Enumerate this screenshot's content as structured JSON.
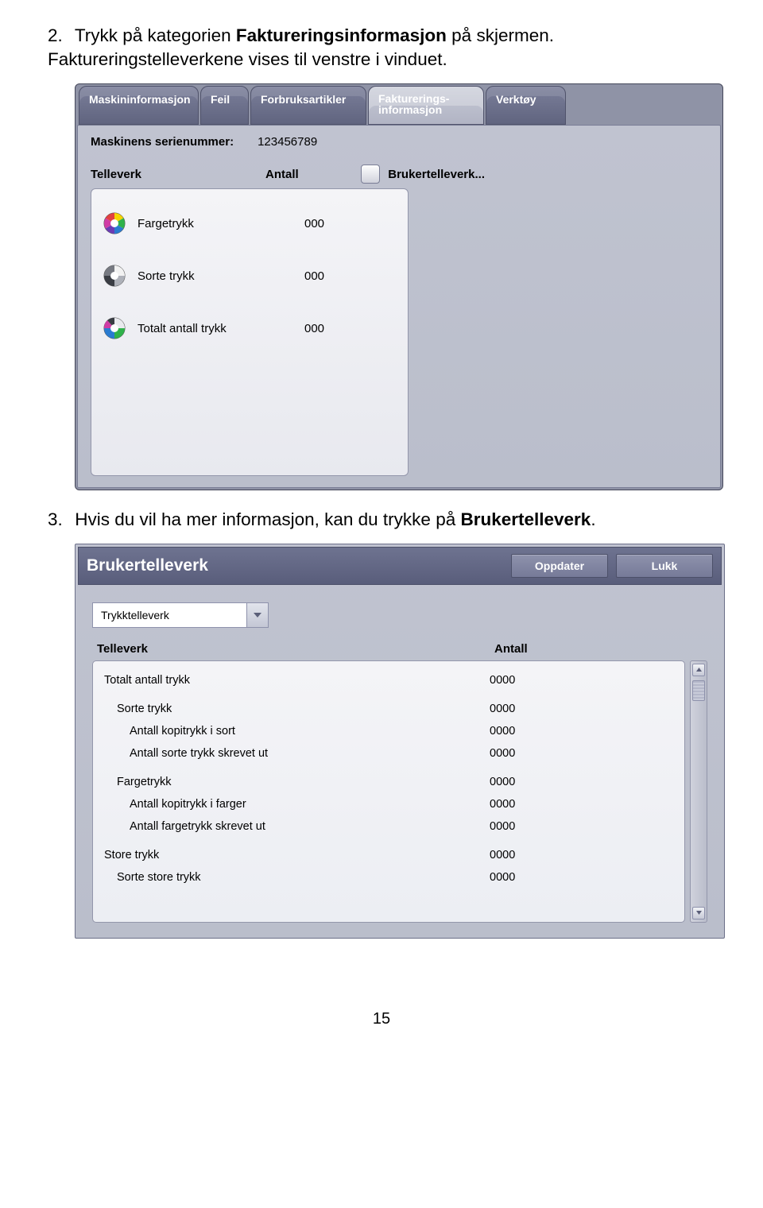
{
  "step2": {
    "num": "2.",
    "text_a": "Trykk på kategorien ",
    "bold": "Faktureringsinformasjon",
    "text_b": " på skjermen. Faktureringstelleverkene vises til venstre i vinduet."
  },
  "ui1": {
    "tabs": {
      "t0": "Maskininformasjon",
      "t1": "Feil",
      "t2": "Forbruksartikler",
      "t3a": "Fakturerings-",
      "t3b": "informasjon",
      "t4": "Verktøy"
    },
    "serial_label": "Maskinens serienummer:",
    "serial_value": "123456789",
    "col_telleverk": "Telleverk",
    "col_antall": "Antall",
    "brukertelleverk": "Brukertelleverk...",
    "items": {
      "i0_label": "Fargetrykk",
      "i0_val": "000",
      "i1_label": "Sorte trykk",
      "i1_val": "000",
      "i2_label": "Totalt antall trykk",
      "i2_val": "000"
    }
  },
  "step3": {
    "num": "3.",
    "text_a": "Hvis du vil ha mer informasjon, kan du trykke på ",
    "bold": "Brukertelleverk",
    "text_b": "."
  },
  "ui2": {
    "title": "Brukertelleverk",
    "btn_update": "Oppdater",
    "btn_close": "Lukk",
    "dropdown": "Trykktelleverk",
    "col_telleverk": "Telleverk",
    "col_antall": "Antall",
    "rows": {
      "r0_label": "Totalt antall trykk",
      "r0_val": "0000",
      "r1_label": "Sorte trykk",
      "r1_val": "0000",
      "r2_label": "Antall kopitrykk i sort",
      "r2_val": "0000",
      "r3_label": "Antall sorte trykk skrevet ut",
      "r3_val": "0000",
      "r4_label": "Fargetrykk",
      "r4_val": "0000",
      "r5_label": "Antall kopitrykk i farger",
      "r5_val": "0000",
      "r6_label": "Antall fargetrykk skrevet ut",
      "r6_val": "0000",
      "r7_label": "Store trykk",
      "r7_val": "0000",
      "r8_label": "Sorte store trykk",
      "r8_val": "0000"
    }
  },
  "page_number": "15"
}
